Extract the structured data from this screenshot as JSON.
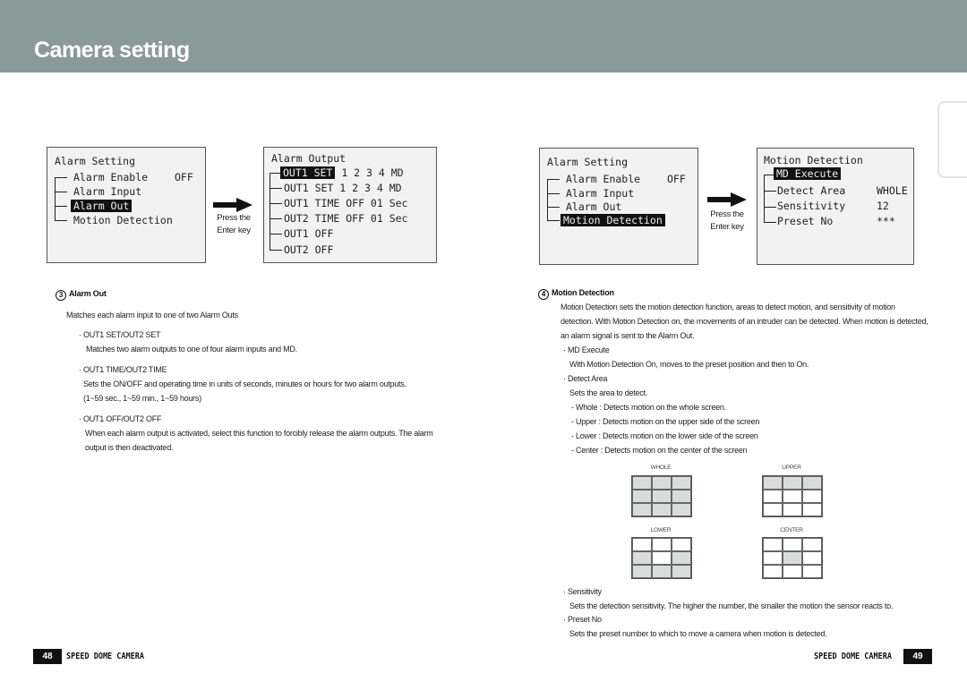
{
  "header": {
    "title": "Camera setting"
  },
  "left_page": {
    "alarm_setting_screen": {
      "title": "Alarm Setting",
      "items": [
        {
          "label": "Alarm Enable",
          "value": "OFF",
          "selected": false
        },
        {
          "label": "Alarm Input",
          "value": "",
          "selected": false
        },
        {
          "label": "Alarm Out",
          "value": "",
          "selected": true
        },
        {
          "label": "Motion Detection",
          "value": "",
          "selected": false
        }
      ]
    },
    "press_note": {
      "line1": "Press the",
      "line2": "Enter key"
    },
    "alarm_output_screen": {
      "title": "Alarm Output",
      "items": [
        {
          "highlight": "OUT1 SET",
          "rest": " 1 2 3 4 MD"
        },
        {
          "highlight": "",
          "rest": "OUT1 SET 1 2 3 4 MD"
        },
        {
          "highlight": "",
          "rest": "OUT1 TIME OFF 01 Sec"
        },
        {
          "highlight": "",
          "rest": "OUT2 TIME OFF 01 Sec"
        },
        {
          "highlight": "",
          "rest": "OUT1 OFF"
        },
        {
          "highlight": "",
          "rest": "OUT2 OFF"
        }
      ]
    },
    "section": {
      "number": "3",
      "heading": "Alarm Out",
      "intro": "Matches each alarm input to one of two Alarm Outs",
      "bullets": [
        {
          "title": "· OUT1 SET/OUT2 SET",
          "lines": [
            "Matches two alarm outputs to one of four alarm inputs and MD."
          ]
        },
        {
          "title": "· OUT1 TIME/OUT2 TIME",
          "lines": [
            "Sets the ON/OFF and operating time in units of seconds, minutes or hours for two alarm outputs.",
            "(1~59 sec., 1~59 min., 1~59 hours)"
          ]
        },
        {
          "title": "· OUT1 OFF/OUT2 OFF",
          "lines": [
            "When each alarm output is activated, select this function to forcibly release the alarm outputs. The alarm",
            "output is then deactivated."
          ]
        }
      ]
    },
    "footer": {
      "page": "48",
      "brand": "SPEED DOME CAMERA"
    }
  },
  "right_page": {
    "alarm_setting_screen": {
      "title": "Alarm Setting",
      "items": [
        {
          "label": "Alarm Enable",
          "value": "OFF",
          "selected": false
        },
        {
          "label": "Alarm Input",
          "value": "",
          "selected": false
        },
        {
          "label": "Alarm Out",
          "value": "",
          "selected": false
        },
        {
          "label": "Motion Detection",
          "value": "",
          "selected": true
        }
      ]
    },
    "press_note": {
      "line1": "Press the",
      "line2": "Enter key"
    },
    "motion_screen": {
      "title": "Motion Detection",
      "items": [
        {
          "label": "MD Execute",
          "value": "",
          "selected": true
        },
        {
          "label": "Detect Area",
          "value": "WHOLE",
          "selected": false
        },
        {
          "label": "Sensitivity",
          "value": "12",
          "selected": false
        },
        {
          "label": "Preset No",
          "value": "***",
          "selected": false
        }
      ]
    },
    "section": {
      "number": "4",
      "heading": "Motion Detection",
      "intro": [
        "Motion Detection sets the motion detection function, areas to detect motion, and sensitivity of motion",
        "detection. With Motion Detection on, the movements of an intruder can be detected. When motion is detected,",
        "an alarm signal is sent to the Alarm Out."
      ],
      "md_execute": {
        "title": "· MD Execute",
        "text": "With Motion Detection On, moves to the preset position and then to On."
      },
      "detect_area": {
        "title": "· Detect Area",
        "text": "Sets the area to detect.",
        "options": [
          "- Whole : Detects motion on the whole screen.",
          "- Upper : Detects motion on the upper side of the screen",
          "- Lower : Detects motion on the lower side of the screen",
          "- Center : Detects motion on the center of the screen"
        ]
      },
      "grids": [
        {
          "label": "WHOLE",
          "cells": [
            1,
            1,
            1,
            1,
            1,
            1,
            1,
            1,
            1
          ]
        },
        {
          "label": "UPPER",
          "cells": [
            1,
            1,
            1,
            0,
            0,
            0,
            0,
            0,
            0
          ]
        },
        {
          "label": "LOWER",
          "cells": [
            0,
            0,
            0,
            1,
            0,
            1,
            1,
            1,
            1
          ]
        },
        {
          "label": "CENTER",
          "cells": [
            0,
            0,
            0,
            0,
            1,
            0,
            0,
            0,
            0
          ]
        }
      ],
      "sensitivity": {
        "title": "· Sensitivity",
        "text": "Sets the detection sensitivity. The higher the number, the smaller the motion the sensor reacts to."
      },
      "preset_no": {
        "title": "· Preset No",
        "text": "Sets the preset number to which to move a camera when motion is detected."
      }
    },
    "footer": {
      "page": "49",
      "brand": "SPEED DOME CAMERA"
    }
  }
}
